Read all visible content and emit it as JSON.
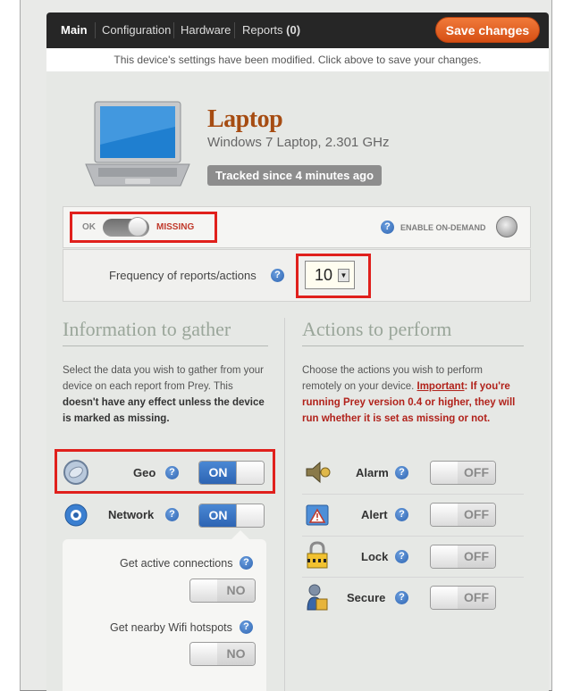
{
  "tabs": [
    {
      "label": "Main",
      "active": true
    },
    {
      "label": "Configuration"
    },
    {
      "label": "Hardware"
    },
    {
      "label": "Reports",
      "count": "(0)"
    }
  ],
  "save_button": "Save changes",
  "notice": "This device's settings have been modified. Click above to save your changes.",
  "device": {
    "name": "Laptop",
    "description": "Windows 7 Laptop, 2.301 GHz",
    "tracked": "Tracked since 4 minutes ago"
  },
  "status": {
    "ok_label": "OK",
    "missing_label": "MISSING",
    "enable_on_demand": "ENABLE ON-DEMAND"
  },
  "frequency": {
    "label": "Frequency of reports/actions",
    "value": "10"
  },
  "info": {
    "heading": "Information to gather",
    "desc_line1": "Select the data you wish to gather from your",
    "desc_line2": "device on each report from Prey. This",
    "desc_line3_bold": "doesn't have any effect unless the device",
    "desc_line4_bold": "is marked as missing."
  },
  "actions": {
    "heading": "Actions to perform",
    "desc_line1": "Choose the actions you wish to perform",
    "desc_line2_plain": "remotely on your device.",
    "desc_important": "Important",
    "desc_line2_red": ": If you're",
    "desc_line3_red": "running Prey version 0.4 or higher, they will",
    "desc_line4_red": "run whether it is set as missing or not."
  },
  "gather_items": [
    {
      "label": "Geo",
      "state": "ON"
    },
    {
      "label": "Network",
      "state": "ON"
    }
  ],
  "network_sub": [
    {
      "label": "Get active connections",
      "state": "NO"
    },
    {
      "label": "Get nearby Wifi hotspots",
      "state": "NO"
    }
  ],
  "action_items": [
    {
      "label": "Alarm",
      "state": "OFF"
    },
    {
      "label": "Alert",
      "state": "OFF"
    },
    {
      "label": "Lock",
      "state": "OFF"
    },
    {
      "label": "Secure",
      "state": "OFF"
    }
  ],
  "help_glyph": "?",
  "select_arrow": "▼"
}
